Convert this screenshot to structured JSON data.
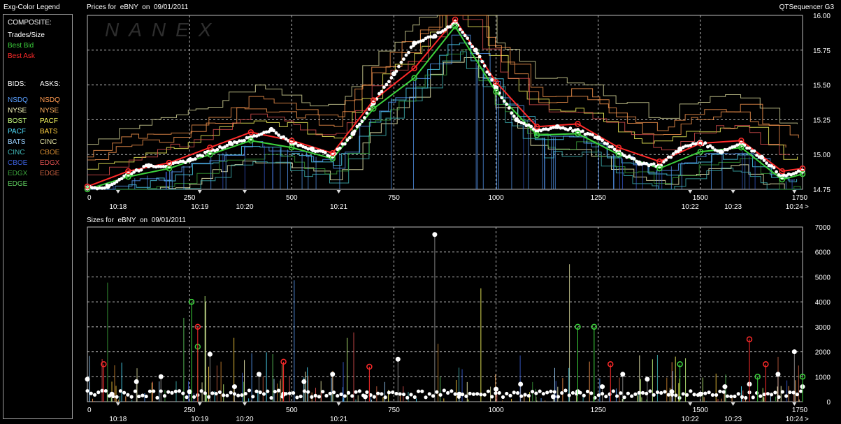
{
  "legend": {
    "title": "Exg-Color Legend",
    "composite_label": "COMPOSITE:",
    "composite_items": [
      {
        "label": "Trades/Size",
        "color": "#ffffff"
      },
      {
        "label": "Best Bid",
        "color": "#3cd23c"
      },
      {
        "label": "Best Ask",
        "color": "#ff2a2a"
      }
    ],
    "bids_label": "BIDS:",
    "asks_label": "ASKS:",
    "bids": [
      {
        "label": "NSDQ",
        "color": "#5aa0ff"
      },
      {
        "label": "NYSE",
        "color": "#ffffc0"
      },
      {
        "label": "BOST",
        "color": "#c8ff80"
      },
      {
        "label": "PACF",
        "color": "#50e0ff"
      },
      {
        "label": "BATS",
        "color": "#9ad0ff"
      },
      {
        "label": "CINC",
        "color": "#40b8b8"
      },
      {
        "label": "CBOE",
        "color": "#3a5ed8"
      },
      {
        "label": "EDGX",
        "color": "#3aa03a"
      },
      {
        "label": "EDGE",
        "color": "#60d060"
      }
    ],
    "asks": [
      {
        "label": "NSDQ",
        "color": "#ff9a50"
      },
      {
        "label": "NYSE",
        "color": "#ffb060"
      },
      {
        "label": "PACF",
        "color": "#ffff60"
      },
      {
        "label": "BATS",
        "color": "#ffd040"
      },
      {
        "label": "CINC",
        "color": "#e0e0a0"
      },
      {
        "label": "CBOE",
        "color": "#d08830"
      },
      {
        "label": "EDGX",
        "color": "#e05050"
      },
      {
        "label": "EDGE",
        "color": "#c86040"
      }
    ]
  },
  "header": {
    "app_name": "QTSequencer G3",
    "watermark": "NANEX"
  },
  "chart_data": [
    {
      "type": "line",
      "title": "Prices for  eBNY  on  09/01/2011",
      "ylim": [
        14.75,
        16.0
      ],
      "yticks": [
        "16.00",
        "15.75",
        "15.50",
        "15.25",
        "15.00",
        "14.75"
      ],
      "xlim": [
        0,
        1750
      ],
      "xticks": [
        "0",
        "250",
        "500",
        "750",
        "1000",
        "1250",
        "1500",
        "1750"
      ],
      "time_labels": [
        {
          "label": "10:18",
          "x": 75
        },
        {
          "label": "10:19",
          "x": 275
        },
        {
          "label": "10:20",
          "x": 385
        },
        {
          "label": "10:21",
          "x": 615
        },
        {
          "label": "10:22",
          "x": 1475
        },
        {
          "label": "10:23",
          "x": 1580
        },
        {
          "label": "10:24",
          "x": 1730
        }
      ],
      "axis_end_label": ">",
      "series": [
        {
          "name": "Trades/Size",
          "color": "#ffffff",
          "x": [
            0,
            50,
            100,
            150,
            200,
            250,
            300,
            350,
            400,
            450,
            500,
            550,
            600,
            650,
            700,
            750,
            800,
            850,
            900,
            950,
            1000,
            1050,
            1100,
            1150,
            1200,
            1250,
            1300,
            1350,
            1400,
            1450,
            1500,
            1550,
            1600,
            1650,
            1700,
            1750
          ],
          "y": [
            14.76,
            14.77,
            14.86,
            14.92,
            14.92,
            14.96,
            15.02,
            15.08,
            15.12,
            15.18,
            15.08,
            15.04,
            14.99,
            15.15,
            15.37,
            15.58,
            15.8,
            15.85,
            15.95,
            15.75,
            15.48,
            15.25,
            15.17,
            15.2,
            15.17,
            15.12,
            15.02,
            14.94,
            14.92,
            15.04,
            15.09,
            15.02,
            15.08,
            14.98,
            14.84,
            14.88
          ]
        },
        {
          "name": "Best Bid",
          "color": "#3cd23c",
          "x": [
            0,
            100,
            200,
            300,
            400,
            500,
            600,
            700,
            800,
            900,
            1000,
            1100,
            1200,
            1300,
            1400,
            1500,
            1600,
            1700,
            1750
          ],
          "y": [
            14.75,
            14.84,
            14.9,
            15.0,
            15.1,
            15.05,
            14.97,
            15.33,
            15.55,
            15.92,
            15.45,
            15.14,
            15.15,
            15.0,
            14.9,
            15.02,
            15.05,
            14.82,
            14.86
          ]
        },
        {
          "name": "Best Ask",
          "color": "#ff2a2a",
          "x": [
            0,
            100,
            200,
            300,
            400,
            500,
            600,
            700,
            800,
            900,
            1000,
            1100,
            1200,
            1300,
            1400,
            1500,
            1600,
            1700,
            1750
          ],
          "y": [
            14.77,
            14.88,
            14.94,
            15.05,
            15.16,
            15.1,
            15.01,
            15.39,
            15.62,
            15.97,
            15.52,
            15.2,
            15.22,
            15.05,
            14.95,
            15.08,
            15.1,
            14.88,
            14.9
          ]
        }
      ]
    },
    {
      "type": "scatter",
      "title": "Sizes for  eBNY  on  09/01/2011",
      "ylim": [
        0,
        7000
      ],
      "yticks": [
        "7000",
        "6000",
        "5000",
        "4000",
        "3000",
        "2000",
        "1000",
        "0"
      ],
      "xlim": [
        0,
        1750
      ],
      "xticks": [
        "0",
        "250",
        "500",
        "750",
        "1000",
        "1250",
        "1500",
        "1750"
      ],
      "time_labels": [
        {
          "label": "10:18",
          "x": 75
        },
        {
          "label": "10:19",
          "x": 275
        },
        {
          "label": "10:20",
          "x": 385
        },
        {
          "label": "10:21",
          "x": 615
        },
        {
          "label": "10:22",
          "x": 1475
        },
        {
          "label": "10:23",
          "x": 1580
        },
        {
          "label": "10:24",
          "x": 1730
        }
      ],
      "axis_end_label": ">",
      "series": [
        {
          "name": "Trades/Size",
          "color": "#ffffff",
          "x": [
            0,
            60,
            120,
            180,
            250,
            300,
            360,
            420,
            480,
            530,
            600,
            680,
            760,
            850,
            910,
            1000,
            1060,
            1140,
            1200,
            1260,
            1310,
            1370,
            1430,
            1500,
            1560,
            1620,
            1690,
            1730,
            1750
          ],
          "y": [
            900,
            300,
            800,
            1000,
            400,
            1900,
            600,
            1100,
            300,
            800,
            1100,
            200,
            1700,
            6700,
            300,
            500,
            700,
            200,
            400,
            600,
            1100,
            900,
            400,
            300,
            600,
            700,
            1100,
            2000,
            600
          ]
        },
        {
          "name": "Best Bid",
          "color": "#3cd23c",
          "x": [
            255,
            270,
            1200,
            1240,
            1450,
            1640,
            1750
          ],
          "y": [
            4000,
            2200,
            3000,
            3000,
            1500,
            1000,
            1000
          ]
        },
        {
          "name": "Best Ask",
          "color": "#ff2a2a",
          "x": [
            40,
            270,
            480,
            690,
            1280,
            1620,
            1660
          ],
          "y": [
            1500,
            3000,
            1600,
            1400,
            1500,
            2500,
            1500
          ]
        }
      ]
    }
  ]
}
